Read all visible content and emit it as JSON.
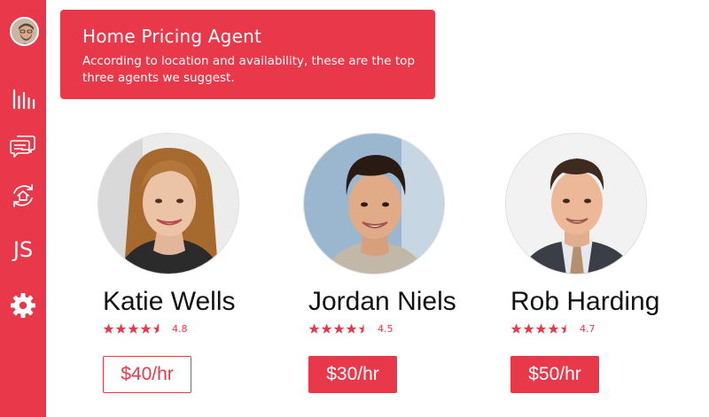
{
  "sidebar": {
    "user_initials": "JS",
    "icons": [
      "user-avatar",
      "bar-chart-icon",
      "chat-icon",
      "home-refresh-icon",
      "settings-gear-icon"
    ]
  },
  "banner": {
    "title": "Home Pricing Agent",
    "description": "According to location and availability, these are the top three agents we suggest."
  },
  "agents": [
    {
      "name": "Katie Wells",
      "rating": "4.8",
      "stars": 4.5,
      "rate": "$40/hr",
      "button_style": "outline"
    },
    {
      "name": "Jordan Niels",
      "rating": "4.5",
      "stars": 4.5,
      "rate": "$30/hr",
      "button_style": "filled"
    },
    {
      "name": "Rob Harding",
      "rating": "4.7",
      "stars": 4.5,
      "rate": "$50/hr",
      "button_style": "filled"
    }
  ],
  "colors": {
    "accent": "#e8384a",
    "text": "#111111",
    "background": "#ffffff"
  }
}
